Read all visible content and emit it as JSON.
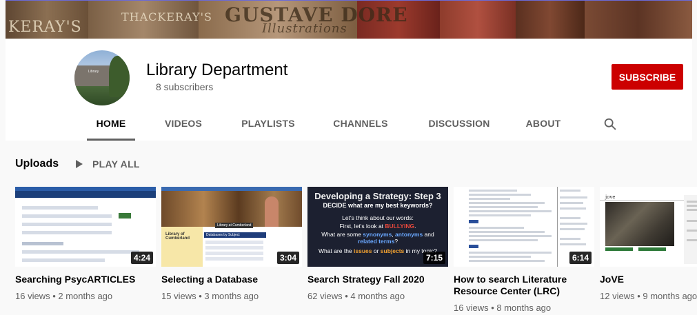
{
  "banner": {
    "words": [
      "KERAY'S",
      "THACKERAY'S",
      "GUSTAVE DORE",
      "Illustrations"
    ]
  },
  "channel": {
    "name": "Library Department",
    "subscribers": "8 subscribers",
    "avatar_label": "Library",
    "subscribe_label": "SUBSCRIBE",
    "accent_color": "#cc0000"
  },
  "tabs": [
    {
      "label": "HOME",
      "active": true
    },
    {
      "label": "VIDEOS",
      "active": false
    },
    {
      "label": "PLAYLISTS",
      "active": false
    },
    {
      "label": "CHANNELS",
      "active": false
    },
    {
      "label": "DISCUSSION",
      "active": false
    },
    {
      "label": "ABOUT",
      "active": false
    }
  ],
  "search_icon": "search-icon",
  "uploads": {
    "heading": "Uploads",
    "play_all_label": "PLAY ALL"
  },
  "videos": [
    {
      "title": "Searching PsycARTICLES",
      "meta": "16 views • 2 months ago",
      "duration": "4:24"
    },
    {
      "title": "Selecting a Database",
      "meta": "15 views • 3 months ago",
      "duration": "3:04",
      "thumb_text": {
        "label": "Library at Cumberland",
        "side": "Library of Cumberland",
        "heading": "Databases by Subject"
      }
    },
    {
      "title": "Search Strategy Fall 2020",
      "meta": "62 views • 4 months ago",
      "duration": "7:15",
      "thumb_text": {
        "heading": "Developing a Strategy: Step 3",
        "subheading": "DECIDE what are my best keywords?",
        "line1": "Let's think about our words:",
        "line2": "First, let's look at BULLYING.",
        "line3": "What are some synonyms, antonyms and related terms?",
        "line4": "What are the issues or subjects in my topic?"
      }
    },
    {
      "title": "How to search Literature Resource Center (LRC)",
      "meta": "16 views • 8 months ago",
      "duration": "6:14"
    },
    {
      "title": "JoVE",
      "meta": "12 views • 9 months ago",
      "duration": "",
      "thumb_text": {
        "logo": "jove"
      }
    }
  ]
}
